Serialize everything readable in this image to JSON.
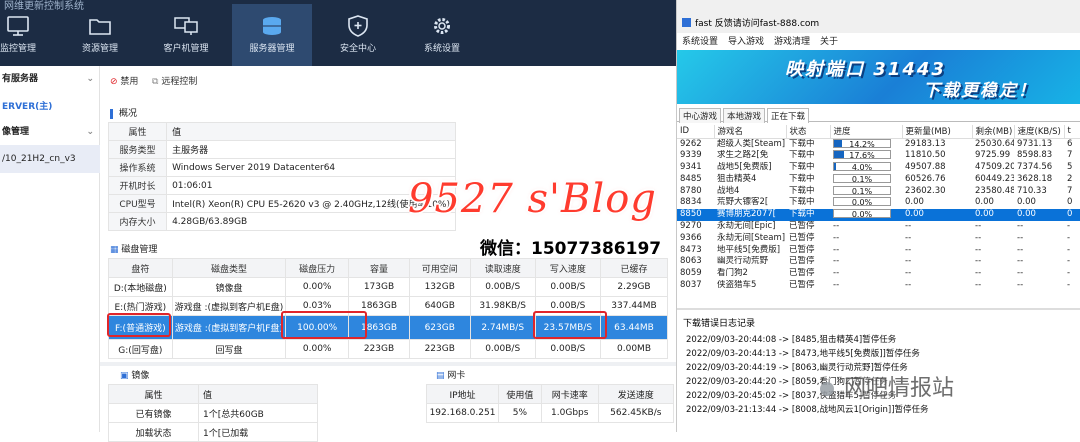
{
  "app": {
    "title_fragment": "网维更新控制系统"
  },
  "nav": [
    {
      "label": "监控管理",
      "icon": "monitor-icon"
    },
    {
      "label": "资源管理",
      "icon": "folder-icon"
    },
    {
      "label": "客户机管理",
      "icon": "computers-icon"
    },
    {
      "label": "服务器管理",
      "icon": "server-icon",
      "active": true
    },
    {
      "label": "安全中心",
      "icon": "shield-icon"
    },
    {
      "label": "系统设置",
      "icon": "gear-icon"
    }
  ],
  "sidebar": {
    "all_servers": "有服务器",
    "server_main": "ERVER(主)",
    "image_manage": "像管理",
    "image_item": "/10_21H2_cn_v3"
  },
  "toolbar": {
    "disable": "禁用",
    "remote": "远程控制"
  },
  "overview": {
    "title": "概况",
    "header": [
      "属性",
      "值"
    ],
    "rows": [
      [
        "服务类型",
        "主服务器"
      ],
      [
        "操作系统",
        "Windows Server 2019 Datacenter64"
      ],
      [
        "开机时长",
        "01:06:01"
      ],
      [
        "CPU型号",
        "Intel(R) Xeon(R) CPU E5-2620 v3 @ 2.40GHz,12线(使用率10%)"
      ],
      [
        "内存大小",
        "4.28GB/63.89GB"
      ]
    ]
  },
  "disk": {
    "title": "磁盘管理",
    "headers": [
      "盘符",
      "磁盘类型",
      "磁盘压力",
      "容量",
      "可用空间",
      "读取速度",
      "写入速度",
      "已缓存"
    ],
    "rows": [
      [
        "D:(本地磁盘)",
        "镜像盘",
        "0.00%",
        "173GB",
        "132GB",
        "0.00B/S",
        "0.00B/S",
        "2.29GB"
      ],
      [
        "E:(热门游戏)",
        "游戏盘 :(虚拟到客户机E盘)",
        "0.03%",
        "1863GB",
        "640GB",
        "31.98KB/S",
        "0.00B/S",
        "337.44MB"
      ],
      [
        "F:(普通游戏)",
        "游戏盘 :(虚拟到客户机F盘)",
        "100.00%",
        "1863GB",
        "623GB",
        "2.74MB/S",
        "23.57MB/S",
        "63.44MB"
      ],
      [
        "G:(回写盘)",
        "回写盘",
        "0.00%",
        "223GB",
        "223GB",
        "0.00B/S",
        "0.00B/S",
        "0.00MB"
      ]
    ]
  },
  "image": {
    "title": "镜像",
    "header": [
      "属性",
      "值"
    ],
    "rows": [
      [
        "已有镜像",
        "1个[总共60GB"
      ],
      [
        "加载状态",
        "1个[已加载"
      ]
    ]
  },
  "nic": {
    "title": "网卡",
    "headers": [
      "IP地址",
      "使用值",
      "网卡速率",
      "发送速度"
    ],
    "rows": [
      [
        "192.168.0.251",
        "5%",
        "1.0Gbps",
        "562.45KB/s"
      ]
    ]
  },
  "watermark": {
    "blog": "9527 s'Blog",
    "wechat": "微信：15077386197",
    "footer": "网吧情报站"
  },
  "right": {
    "title": "fast 反馈请访问fast-888.com",
    "menu": [
      "系统设置",
      "导入游戏",
      "游戏清理",
      "关于"
    ],
    "banner_line1": "映射端口 31443",
    "banner_line2": "下载更稳定！",
    "tabs": [
      "中心游戏",
      "本地游戏",
      "正在下载"
    ],
    "columns": [
      "ID",
      "游戏名",
      "状态",
      "进度",
      "更新量(MB)",
      "剩余(MB)",
      "速度(KB/S)",
      "t"
    ],
    "rows": [
      {
        "id": "9262",
        "name": "超级人类[Steam]",
        "status": "下载中",
        "pct": 14.2,
        "pct_text": "14.2%",
        "upd": "29183.13",
        "left": "25030.64",
        "speed": "9731.13",
        "t": "6"
      },
      {
        "id": "9339",
        "name": "求生之路2[免",
        "status": "下载中",
        "pct": 17.6,
        "pct_text": "17.6%",
        "upd": "11810.50",
        "left": "9725.99",
        "speed": "8598.83",
        "t": "7"
      },
      {
        "id": "9341",
        "name": "战地5[免费版]",
        "status": "下载中",
        "pct": 4.0,
        "pct_text": "4.0%",
        "upd": "49507.88",
        "left": "47509.20",
        "speed": "7374.56",
        "t": "5"
      },
      {
        "id": "8485",
        "name": "狙击精英4",
        "status": "下载中",
        "pct": 0.1,
        "pct_text": "0.1%",
        "upd": "60526.76",
        "left": "60449.23",
        "speed": "3628.18",
        "t": "2"
      },
      {
        "id": "8780",
        "name": "战地4",
        "status": "下载中",
        "pct": 0.1,
        "pct_text": "0.1%",
        "upd": "23602.30",
        "left": "23580.48",
        "speed": "710.33",
        "t": "7"
      },
      {
        "id": "8834",
        "name": "荒野大镖客2[",
        "status": "下载中",
        "pct": 0.0,
        "pct_text": "0.0%",
        "upd": "0.00",
        "left": "0.00",
        "speed": "0.00",
        "t": "0"
      },
      {
        "id": "8850",
        "name": "赛博朋克2077[",
        "status": "下载中",
        "pct": 0.0,
        "pct_text": "0.0%",
        "upd": "0.00",
        "left": "0.00",
        "speed": "0.00",
        "t": "0",
        "selected": true
      },
      {
        "id": "9270",
        "name": "永劫无间[Epic]",
        "status": "已暂停",
        "pct": null,
        "pct_text": "--",
        "upd": "--",
        "left": "--",
        "speed": "--",
        "t": "-"
      },
      {
        "id": "9366",
        "name": "永劫无间[Steam]",
        "status": "已暂停",
        "pct": null,
        "pct_text": "--",
        "upd": "--",
        "left": "--",
        "speed": "--",
        "t": "-"
      },
      {
        "id": "8473",
        "name": "地平线5[免费版]",
        "status": "已暂停",
        "pct": null,
        "pct_text": "--",
        "upd": "--",
        "left": "--",
        "speed": "--",
        "t": "-"
      },
      {
        "id": "8063",
        "name": "幽灵行动荒野",
        "status": "已暂停",
        "pct": null,
        "pct_text": "--",
        "upd": "--",
        "left": "--",
        "speed": "--",
        "t": "-"
      },
      {
        "id": "8059",
        "name": "看门狗2",
        "status": "已暂停",
        "pct": null,
        "pct_text": "--",
        "upd": "--",
        "left": "--",
        "speed": "--",
        "t": "-"
      },
      {
        "id": "8037",
        "name": "侠盗猎车5",
        "status": "已暂停",
        "pct": null,
        "pct_text": "--",
        "upd": "--",
        "left": "--",
        "speed": "--",
        "t": "-"
      }
    ],
    "log_title": "下载错误日志记录",
    "logs": [
      "2022/09/03-20:44:08 -> [8485,狙击精英4]暂停任务",
      "2022/09/03-20:44:13 -> [8473,地平线5[免费版]]暂停任务",
      "2022/09/03-20:44:19 -> [8063,幽灵行动荒野]暂停任务",
      "2022/09/03-20:44:20 -> [8059,看门狗2]暂停任务",
      "2022/09/03-20:45:02 -> [8037,侠盗猎车5]暂停任务",
      "2022/09/03-21:13:44 -> [8008,战地风云1[Origin]]暂停任务"
    ]
  }
}
